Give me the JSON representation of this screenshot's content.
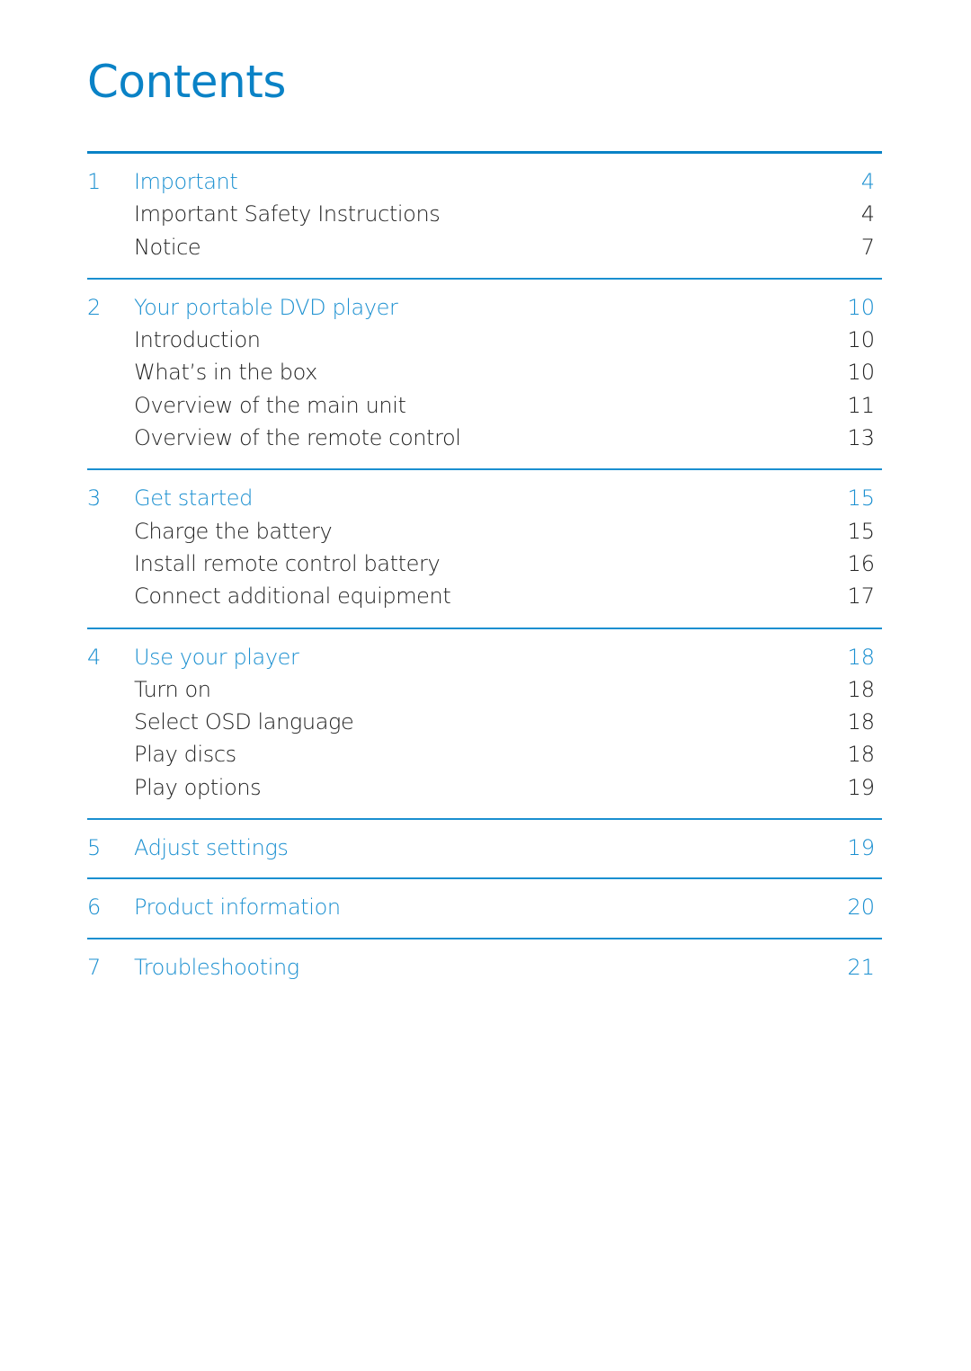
{
  "title": "Contents",
  "colors": {
    "accent": "#1a8fd0",
    "text": "#222222"
  },
  "sections": [
    {
      "number": "1",
      "title": "Important",
      "page": "4",
      "items": [
        {
          "label": "Important Safety Instructions",
          "page": "4"
        },
        {
          "label": "Notice",
          "page": "7"
        }
      ]
    },
    {
      "number": "2",
      "title": "Your portable DVD player",
      "page": "10",
      "items": [
        {
          "label": "Introduction",
          "page": "10"
        },
        {
          "label": "What’s in the box",
          "page": "10"
        },
        {
          "label": "Overview of the main unit",
          "page": "11"
        },
        {
          "label": "Overview of the remote control",
          "page": "13"
        }
      ]
    },
    {
      "number": "3",
      "title": "Get started",
      "page": "15",
      "items": [
        {
          "label": "Charge the battery",
          "page": "15"
        },
        {
          "label": "Install remote control battery",
          "page": "16"
        },
        {
          "label": "Connect additional equipment",
          "page": "17"
        }
      ]
    },
    {
      "number": "4",
      "title": "Use your player",
      "page": "18",
      "items": [
        {
          "label": "Turn on",
          "page": "18"
        },
        {
          "label": "Select OSD language",
          "page": "18"
        },
        {
          "label": "Play discs",
          "page": "18"
        },
        {
          "label": "Play options",
          "page": "19"
        }
      ]
    },
    {
      "number": "5",
      "title": "Adjust settings",
      "page": "19",
      "items": []
    },
    {
      "number": "6",
      "title": "Product information",
      "page": "20",
      "items": []
    },
    {
      "number": "7",
      "title": "Troubleshooting",
      "page": "21",
      "items": []
    }
  ]
}
